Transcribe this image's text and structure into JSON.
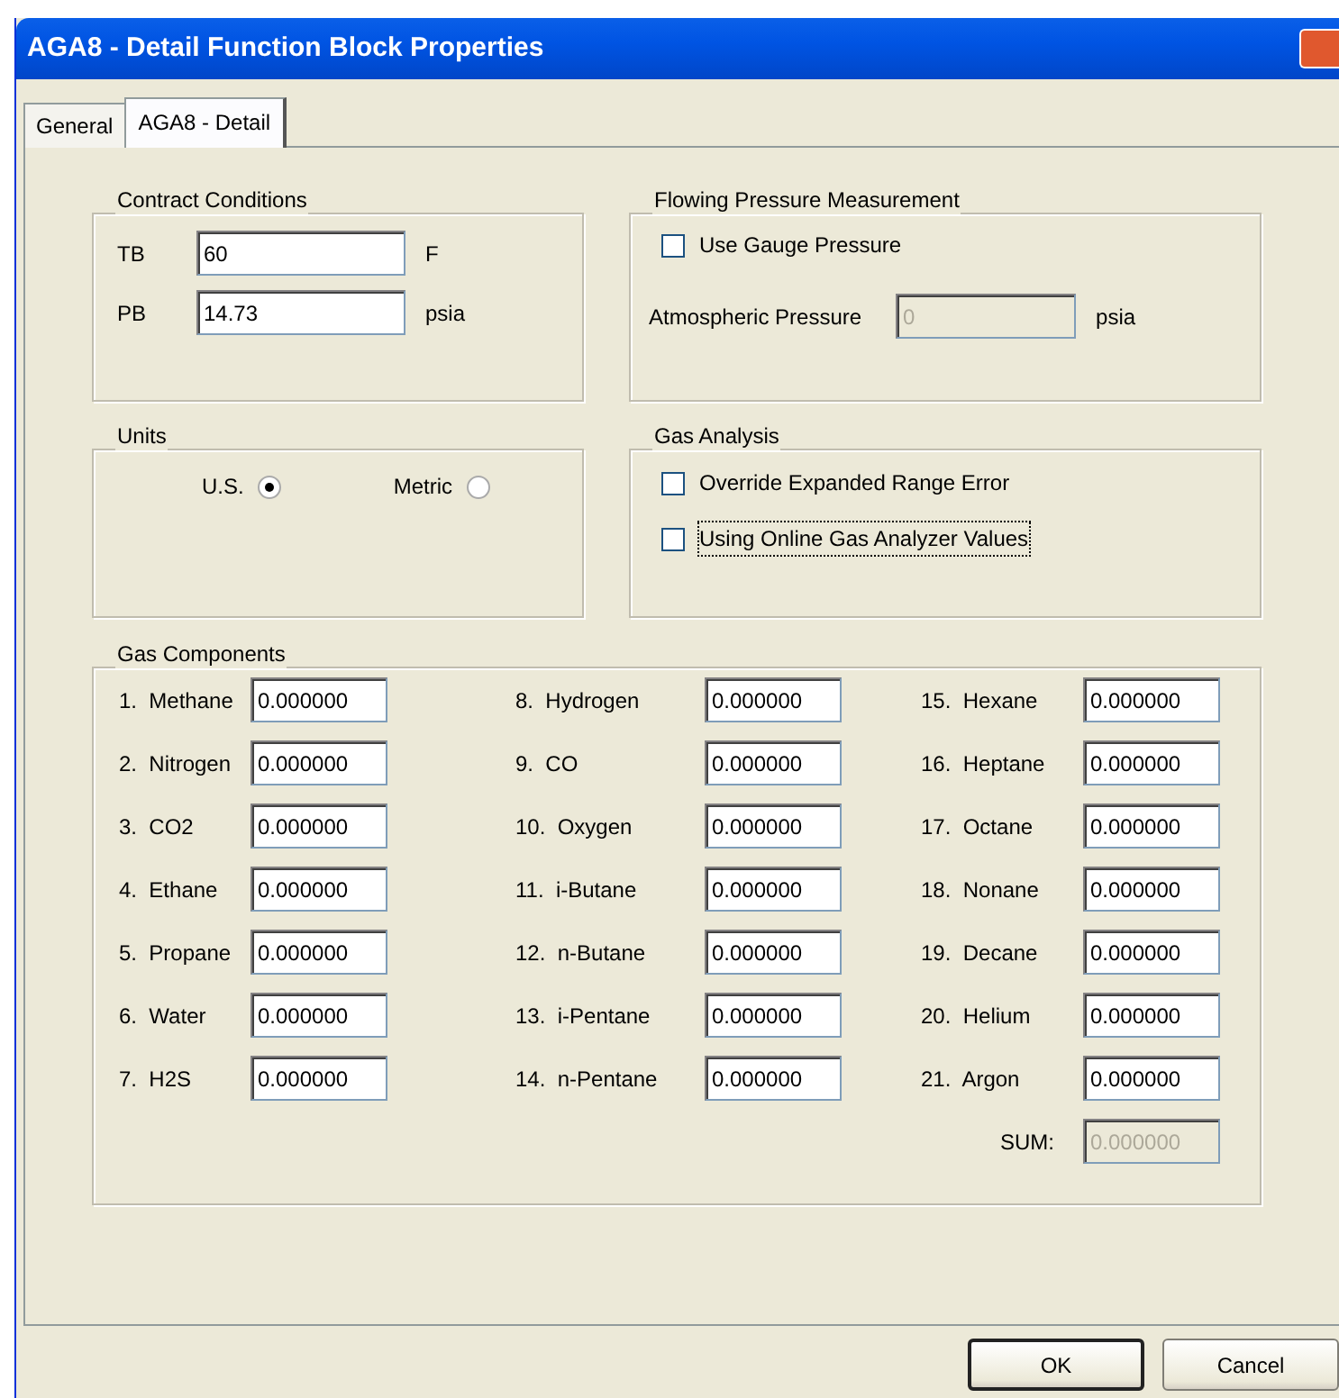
{
  "window": {
    "title": "AGA8 - Detail Function Block Properties"
  },
  "tabs": [
    {
      "label": "General",
      "selected": false
    },
    {
      "label": "AGA8 - Detail",
      "selected": true
    }
  ],
  "contract_conditions": {
    "title": "Contract Conditions",
    "fields": [
      {
        "label": "TB",
        "value": "60",
        "unit": "F"
      },
      {
        "label": "PB",
        "value": "14.73",
        "unit": "psia"
      }
    ]
  },
  "flowing_pressure": {
    "title": "Flowing Pressure Measurement",
    "checkbox": {
      "label": "Use Gauge Pressure",
      "checked": false
    },
    "field": {
      "label": "Atmospheric Pressure",
      "value": "0",
      "unit": "psia",
      "disabled": true
    }
  },
  "units": {
    "title": "Units",
    "options": [
      {
        "label": "U.S.",
        "selected": true
      },
      {
        "label": "Metric",
        "selected": false
      }
    ]
  },
  "gas_analysis": {
    "title": "Gas Analysis",
    "checkboxes": [
      {
        "label": "Override Expanded Range Error",
        "checked": false,
        "focused": false
      },
      {
        "label": "Using Online Gas Analyzer Values",
        "checked": false,
        "focused": true
      }
    ]
  },
  "gas_components": {
    "title": "Gas Components",
    "items": [
      {
        "number": "1.",
        "name": "Methane",
        "value": "0.000000"
      },
      {
        "number": "2.",
        "name": "Nitrogen",
        "value": "0.000000"
      },
      {
        "number": "3.",
        "name": "CO2",
        "value": "0.000000"
      },
      {
        "number": "4.",
        "name": "Ethane",
        "value": "0.000000"
      },
      {
        "number": "5.",
        "name": "Propane",
        "value": "0.000000"
      },
      {
        "number": "6.",
        "name": "Water",
        "value": "0.000000"
      },
      {
        "number": "7.",
        "name": "H2S",
        "value": "0.000000"
      },
      {
        "number": "8.",
        "name": "Hydrogen",
        "value": "0.000000"
      },
      {
        "number": "9.",
        "name": "CO",
        "value": "0.000000"
      },
      {
        "number": "10.",
        "name": "Oxygen",
        "value": "0.000000"
      },
      {
        "number": "11.",
        "name": "i-Butane",
        "value": "0.000000"
      },
      {
        "number": "12.",
        "name": "n-Butane",
        "value": "0.000000"
      },
      {
        "number": "13.",
        "name": "i-Pentane",
        "value": "0.000000"
      },
      {
        "number": "14.",
        "name": "n-Pentane",
        "value": "0.000000"
      },
      {
        "number": "15.",
        "name": "Hexane",
        "value": "0.000000"
      },
      {
        "number": "16.",
        "name": "Heptane",
        "value": "0.000000"
      },
      {
        "number": "17.",
        "name": "Octane",
        "value": "0.000000"
      },
      {
        "number": "18.",
        "name": "Nonane",
        "value": "0.000000"
      },
      {
        "number": "19.",
        "name": "Decane",
        "value": "0.000000"
      },
      {
        "number": "20.",
        "name": "Helium",
        "value": "0.000000"
      },
      {
        "number": "21.",
        "name": "Argon",
        "value": "0.000000"
      }
    ],
    "sum": {
      "label": "SUM:",
      "value": "0.000000",
      "disabled": true
    }
  },
  "buttons": [
    {
      "label": "OK",
      "default": true
    },
    {
      "label": "Cancel",
      "default": false
    }
  ]
}
